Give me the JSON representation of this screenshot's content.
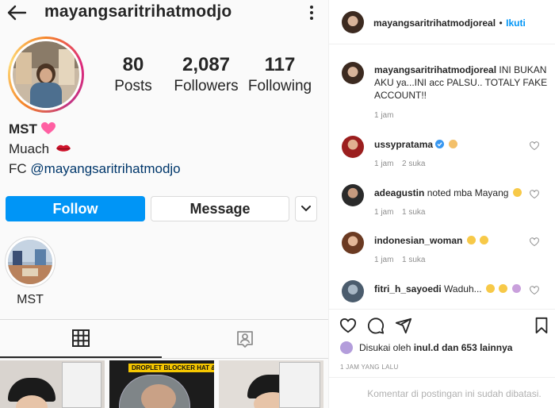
{
  "profile": {
    "username": "mayangsaritrihatmodjo",
    "stats": {
      "posts_count": "80",
      "posts_label": "Posts",
      "followers_count": "2,087",
      "followers_label": "Followers",
      "following_count": "117",
      "following_label": "Following"
    },
    "bio": {
      "name": "MST",
      "line2": "Muach",
      "line3_prefix": "FC",
      "line3_link": "@mayangsaritrihatmodjo"
    },
    "buttons": {
      "follow": "Follow",
      "message": "Message"
    },
    "highlight": {
      "label": "MST"
    },
    "thumb_caption": "DROPLET BLOCKER HAT & CAP"
  },
  "post": {
    "author": "mayangsaritrihatmodjoreal",
    "separator": "•",
    "follow_label": "Ikuti",
    "caption_user": "mayangsaritrihatmodjoreal",
    "caption_text": "INI BUKAN AKU ya...INI acc PALSU.. TOTALY FAKE ACCOUNT!!",
    "caption_time": "1 jam",
    "comments": [
      {
        "user": "ussypratama",
        "text": "",
        "time": "1 jam",
        "likes": "2 suka"
      },
      {
        "user": "adeagustin",
        "text": "noted mba Mayang",
        "time": "1 jam",
        "likes": "1 suka"
      },
      {
        "user": "indonesian_woman",
        "text": "",
        "time": "1 jam",
        "likes": "1 suka"
      },
      {
        "user": "fitri_h_sayoedi",
        "text": "Waduh...",
        "time": "",
        "likes": ""
      }
    ],
    "liked_by_prefix": "Disukai oleh",
    "liked_by_user": "inul.d",
    "liked_by_suffix": "dan 653 lainnya",
    "timestamp": "1 JAM YANG LALU",
    "comments_disabled": "Komentar di postingan ini sudah dibatasi."
  },
  "colors": {
    "accent_blue": "#0095f6",
    "text": "#262626",
    "muted": "#8e8e8e"
  }
}
